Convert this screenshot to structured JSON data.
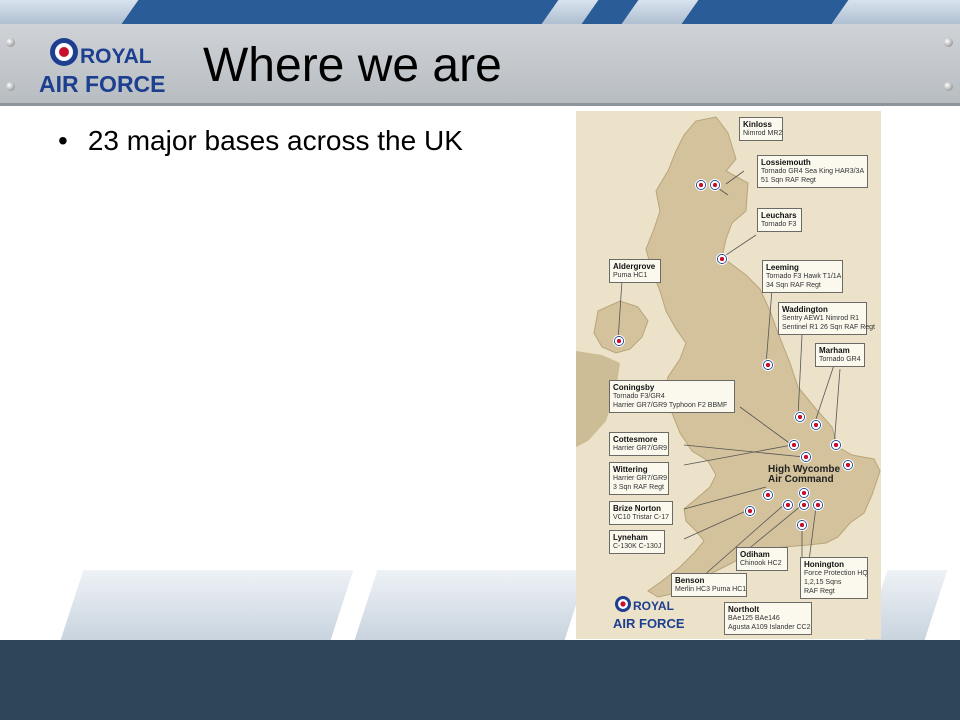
{
  "slide": {
    "title": "Where we are",
    "bullet": "23 major bases across the UK",
    "logo": {
      "line1": "ROYAL",
      "line2": "AIR FORCE"
    }
  },
  "map": {
    "aircommand": {
      "line1": "High Wycombe",
      "line2": "Air Command"
    },
    "callouts": [
      {
        "name": "Kinloss",
        "lines": [
          "Nimrod MR2"
        ]
      },
      {
        "name": "Lossiemouth",
        "lines": [
          "Tornado GR4  Sea King HAR3/3A",
          "51 Sqn RAF Regt"
        ]
      },
      {
        "name": "Leuchars",
        "lines": [
          "Tornado F3"
        ]
      },
      {
        "name": "Aldergrove",
        "lines": [
          "Puma HC1"
        ]
      },
      {
        "name": "Leeming",
        "lines": [
          "Tornado F3 Hawk T1/1A",
          "34 Sqn RAF Regt"
        ]
      },
      {
        "name": "Waddington",
        "lines": [
          "Sentry AEW1  Nimrod R1",
          "Sentinel R1 26 Sqn RAF Regt"
        ]
      },
      {
        "name": "Marham",
        "lines": [
          "Tornado GR4"
        ]
      },
      {
        "name": "Coningsby",
        "lines": [
          "Tornado F3/GR4",
          "Harrier GR7/GR9  Typhoon F2  BBMF"
        ]
      },
      {
        "name": "Cottesmore",
        "lines": [
          "Harrier GR7/GR9"
        ]
      },
      {
        "name": "Wittering",
        "lines": [
          "Harrier GR7/GR9",
          "3 Sqn RAF Regt"
        ]
      },
      {
        "name": "Brize Norton",
        "lines": [
          "VC10  Tristar  C-17"
        ]
      },
      {
        "name": "Lyneham",
        "lines": [
          "C-130K  C-130J"
        ]
      },
      {
        "name": "Odiham",
        "lines": [
          "Chinook HC2"
        ]
      },
      {
        "name": "Benson",
        "lines": [
          "Merlin HC3  Puma HC1"
        ]
      },
      {
        "name": "Honington",
        "lines": [
          "Force Protection HQ",
          "1,2,15 Sqns",
          "RAF Regt"
        ]
      },
      {
        "name": "Northolt",
        "lines": [
          "BAe125  BAe146",
          "Agusta A109  Islander CC2"
        ]
      }
    ]
  },
  "colors": {
    "raf_red": "#c8102e",
    "raf_blue": "#1d3f8f",
    "footer": "#2f4558"
  }
}
